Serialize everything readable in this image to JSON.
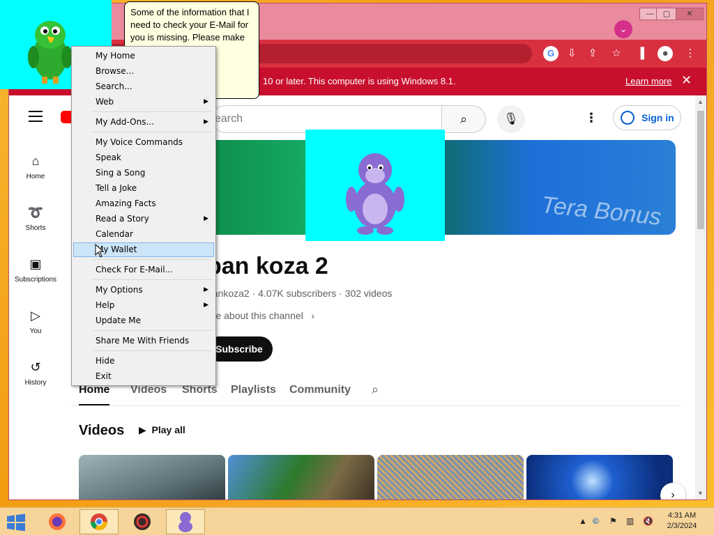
{
  "browser": {
    "window_controls": {
      "minimize": "—",
      "maximize": "▢",
      "close": "✕"
    },
    "profile_icon": "chevron-down-icon",
    "infobar": {
      "message": "10 or later. This computer is using Windows 8.1.",
      "learn_more": "Learn more",
      "close": "✕"
    }
  },
  "youtube": {
    "search": {
      "placeholder": "earch"
    },
    "signin_label": "Sign in",
    "nav": [
      {
        "label": "Home",
        "icon": "⌂"
      },
      {
        "label": "Shorts",
        "icon": "➰"
      },
      {
        "label": "Subscriptions",
        "icon": "▣"
      },
      {
        "label": "You",
        "icon": "▷"
      },
      {
        "label": "History",
        "icon": "↺"
      }
    ],
    "banner_text": "Tera Bonus",
    "channel": {
      "name": "ban koza 2",
      "meta": "pankoza2 · 4.07K subscribers · 302 videos",
      "more": "ore about this channel",
      "subscribe": "Subscribe"
    },
    "tabs": [
      "Home",
      "Videos",
      "Shorts",
      "Playlists",
      "Community"
    ],
    "section_title": "Videos",
    "play_all": "Play all"
  },
  "agent": {
    "balloon_text": "Some of the information that I need to check your E-Mail for you is missing. Please make sure your E-Mail"
  },
  "context_menu": {
    "items": [
      {
        "label": "My Home",
        "arrow": ""
      },
      {
        "label": "Browse...",
        "arrow": ""
      },
      {
        "label": "Search...",
        "arrow": ""
      },
      {
        "label": "Web",
        "arrow": "▶"
      },
      {
        "label": "My Add-Ons...",
        "arrow": "▶"
      },
      {
        "label": "My Voice Commands",
        "arrow": ""
      },
      {
        "label": "Speak",
        "arrow": ""
      },
      {
        "label": "Sing a Song",
        "arrow": ""
      },
      {
        "label": "Tell a Joke",
        "arrow": ""
      },
      {
        "label": "Amazing Facts",
        "arrow": ""
      },
      {
        "label": "Read a Story",
        "arrow": "▶"
      },
      {
        "label": "Calendar",
        "arrow": ""
      },
      {
        "label": "My Wallet",
        "arrow": ""
      },
      {
        "label": "Check For E-Mail...",
        "arrow": ""
      },
      {
        "label": "My Options",
        "arrow": "▶"
      },
      {
        "label": "Help",
        "arrow": "▶"
      },
      {
        "label": "Update Me",
        "arrow": ""
      },
      {
        "label": "Share Me With Friends",
        "arrow": ""
      },
      {
        "label": "Hide",
        "arrow": ""
      },
      {
        "label": "Exit",
        "arrow": ""
      }
    ],
    "highlighted": "My Wallet"
  },
  "taskbar": {
    "clock_time": "4:31 AM",
    "clock_date": "2/3/2024"
  },
  "colors": {
    "browser_frame": "#e98b9c",
    "toolbar": "#d8303f",
    "infobar": "#c8102e",
    "youtube_red": "#ff0000",
    "agent_bg": "#00ffff",
    "menu_highlight": "#cce4f7",
    "taskbar": "#f6d49a"
  }
}
